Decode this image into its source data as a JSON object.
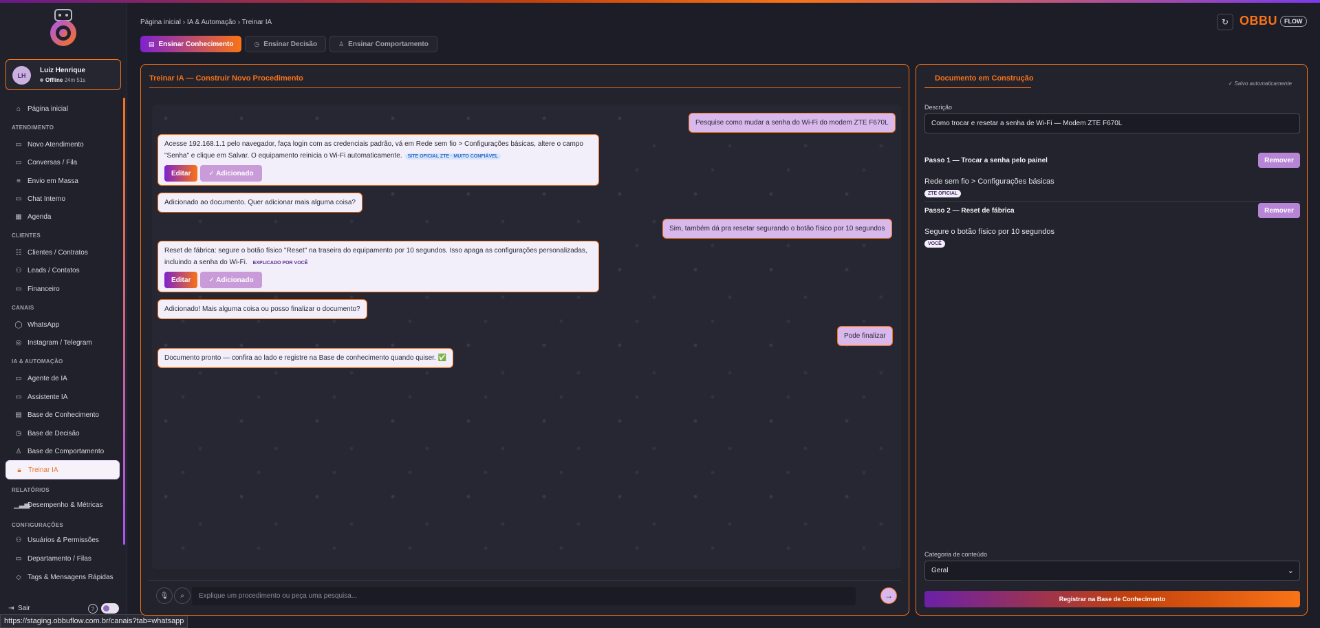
{
  "sidebar": {
    "user": {
      "initials": "LH",
      "name": "Luiz Henrique",
      "status": "Offline",
      "time": "24m 51s"
    },
    "home": "Página inicial",
    "sections": {
      "atendimento": "ATENDIMENTO",
      "clientes": "CLIENTES",
      "canais": "CANAIS",
      "ia": "IA & AUTOMAÇÃO",
      "relatorios": "RELATÓRIOS",
      "config": "CONFIGURAÇÕES"
    },
    "items": {
      "novo_atendimento": "Novo Atendimento",
      "conversas": "Conversas / Fila",
      "envio_massa": "Envio em Massa",
      "chat_interno": "Chat Interno",
      "agenda": "Agenda",
      "clientes_contratos": "Clientes / Contratos",
      "leads": "Leads / Contatos",
      "financeiro": "Financeiro",
      "whatsapp": "WhatsApp",
      "instagram": "Instagram / Telegram",
      "agente_ia": "Agente de IA",
      "assistente_ia": "Assistente IA",
      "base_conhecimento": "Base de Conhecimento",
      "base_decisao": "Base de Decisão",
      "base_comportamento": "Base de Comportamento",
      "treinar_ia": "Treinar IA",
      "desempenho": "Desempenho & Métricas",
      "usuarios": "Usuários & Permissões",
      "departamento": "Departamento / Filas",
      "tags": "Tags & Mensagens Rápidas"
    },
    "logout": "Sair",
    "help": "?"
  },
  "status_url": "https://staging.obbuflow.com.br/canais?tab=whatsapp",
  "header": {
    "breadcrumb": "Página inicial › IA & Automação › Treinar IA",
    "tabs": [
      "Ensinar Conhecimento",
      "Ensinar Decisão",
      "Ensinar Comportamento"
    ],
    "brand": "OBBU",
    "brand_tag": "FLOW"
  },
  "chat": {
    "title": "Treinar IA — Construir Novo Procedimento",
    "messages": {
      "m1": "Pesquise como mudar a senha do Wi-Fi do modem ZTE F670L",
      "m2_line1": "Acesse 192.168.1.1 pelo navegador, faça login com as credenciais padrão, vá em Rede sem fio > Configurações básicas, altere o campo",
      "m2_line2": "\"Senha\" e clique em Salvar. O equipamento reinicia o Wi-Fi automaticamente.",
      "m2_source": "SITE OFICIAL ZTE · MUITO CONFIÁVEL",
      "m3": "Adicionado ao documento. Quer adicionar mais alguma coisa?",
      "m4": "Sim, também dá pra resetar segurando o botão físico por 10 segundos",
      "m5_line1": "Reset de fábrica: segure o botão físico \"Reset\" na traseira do equipamento por 10 segundos. Isso apaga as configurações personalizadas,",
      "m5_line2": "incluindo a senha do Wi-Fi.",
      "m5_source": "EXPLICADO POR VOCÊ",
      "m6": "Adicionado! Mais alguma coisa ou posso finalizar o documento?",
      "m7": "Pode finalizar",
      "m8": "Documento pronto — confira ao lado e registre na Base de conhecimento quando quiser. ✅"
    },
    "edit_label": "Editar",
    "added_label": "✓ Adicionado",
    "input_placeholder": "Explique um procedimento ou peça uma pesquisa..."
  },
  "document": {
    "title": "Documento em Construção",
    "saved": "✓ Salvo automaticamente",
    "desc_label": "Descrição",
    "desc_value": "Como trocar e resetar a senha de Wi-Fi — Modem ZTE F670L",
    "steps": [
      {
        "title": "Passo 1 — Trocar a senha pelo painel",
        "text": "Rede sem fio > Configurações básicas",
        "tag": "ZTE OFICIAL"
      },
      {
        "title": "Passo 2 — Reset de fábrica",
        "text": "Segure o botão físico por 10 segundos",
        "tag": "VOCÊ"
      }
    ],
    "remove_label": "Remover",
    "category_label": "Categoria de conteúdo",
    "category_value": "Geral",
    "register_label": "Registrar na Base de Conhecimento"
  },
  "colors": {
    "accent": "#f97316",
    "brand_purple": "#7e22ce",
    "bubble_user": "#d9b8ec",
    "bubble_bot": "#f3effa"
  }
}
